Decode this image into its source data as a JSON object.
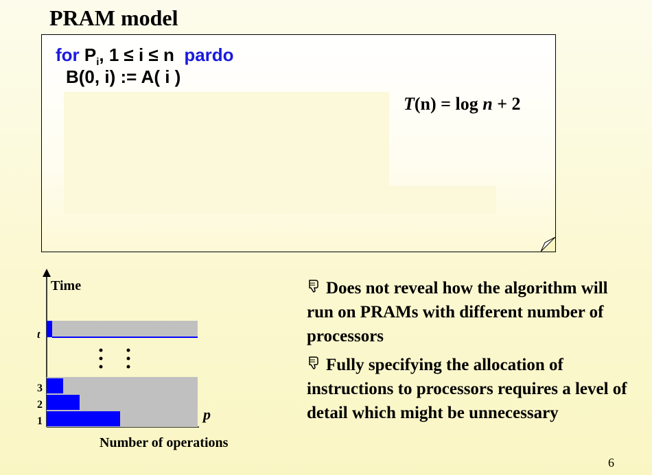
{
  "slide": {
    "title": "PRAM model",
    "page_number": "6"
  },
  "code": {
    "line1_keyword_for": "for ",
    "line1_P": "P",
    "line1_sub_i": "i",
    "line1_range": ", 1 ≤ i ≤ n",
    "line1_keyword_pardo": "pardo",
    "line2": "B(0, i) := A( i )"
  },
  "formula": {
    "T": "T",
    "n_arg": "(n)",
    "equals": " = log ",
    "n": "n",
    "plus": " + 2"
  },
  "chart": {
    "ylabel": "Time",
    "xlabel": "Number of operations",
    "p_label": "p",
    "t_label": "t",
    "tick_labels": [
      "1",
      "2",
      "3"
    ],
    "fill_colors": {
      "used": "#0000ff",
      "idle": "#c0c0c0"
    }
  },
  "bullets": [
    {
      "icon": "thumbs-down-icon",
      "text": "Does not reveal how the algorithm will run on PRAMs with different number of processors"
    },
    {
      "icon": "thumbs-down-icon",
      "text": "Fully specifying the allocation of instructions to processors requires a level of detail which might be unnecessary"
    }
  ]
}
